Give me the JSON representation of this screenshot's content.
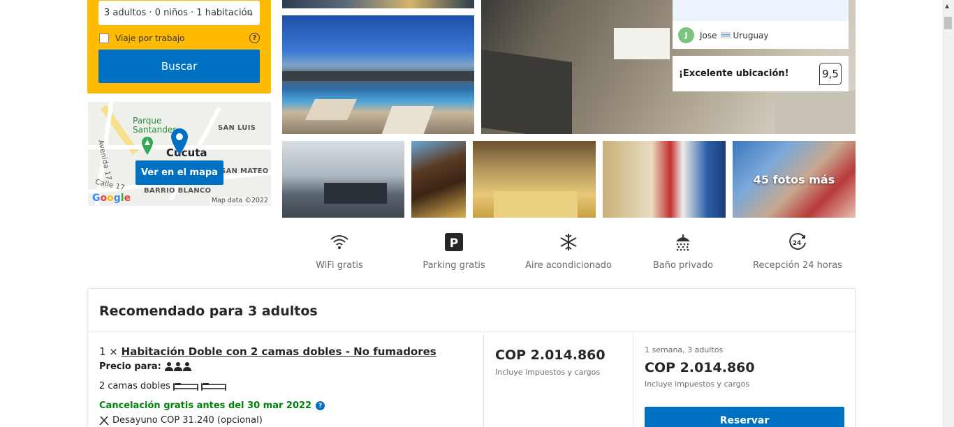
{
  "search": {
    "occupancy": "3 adultos · 0 niños · 1 habitación",
    "work_trip_label": "Viaje por trabajo",
    "search_button": "Buscar"
  },
  "map": {
    "park_line1": "Parque",
    "park_line2": "Santander",
    "city": "Cúcuta",
    "labels": [
      "SAN LUIS",
      "Avenida 17",
      "SAN MATEO",
      "Calle 17",
      "BARRIO BLANCO"
    ],
    "button": "Ver en el mapa",
    "provider": "Google",
    "attribution": "Map data ©2022"
  },
  "review": {
    "reviewer_initial": "J",
    "reviewer_name": "Jose",
    "reviewer_country": "Uruguay",
    "headline": "¡Excelente ubicación!",
    "score": "9,5"
  },
  "photos": {
    "more_label": "45 fotos más"
  },
  "facilities": [
    {
      "icon": "wifi-icon",
      "label": "WiFi gratis"
    },
    {
      "icon": "parking-icon",
      "label": "Parking gratis"
    },
    {
      "icon": "snowflake-icon",
      "label": "Aire acondicionado"
    },
    {
      "icon": "shower-icon",
      "label": "Baño privado"
    },
    {
      "icon": "24h-icon",
      "label": "Recepción 24 horas"
    }
  ],
  "recommendation": {
    "title": "Recomendado para 3 adultos",
    "quantity": "1 ×",
    "room_name": "Habitación Doble con 2 camas dobles - No fumadores",
    "price_for_label": "Precio para:",
    "beds": "2 camas dobles",
    "cancellation": "Cancelación gratis antes del 30 mar 2022",
    "breakfast": "Desayuno COP 31.240 (opcional)",
    "price": "COP 2.014.860",
    "taxes": "Incluye impuestos y cargos",
    "stay_summary": "1 semana, 3 adultos",
    "total_price": "COP 2.014.860",
    "total_taxes": "Incluye impuestos y cargos",
    "reserve_button": "Reservar"
  },
  "colors": {
    "brand_blue": "#0071c2",
    "search_yellow": "#febb02",
    "free_green": "#008009"
  }
}
